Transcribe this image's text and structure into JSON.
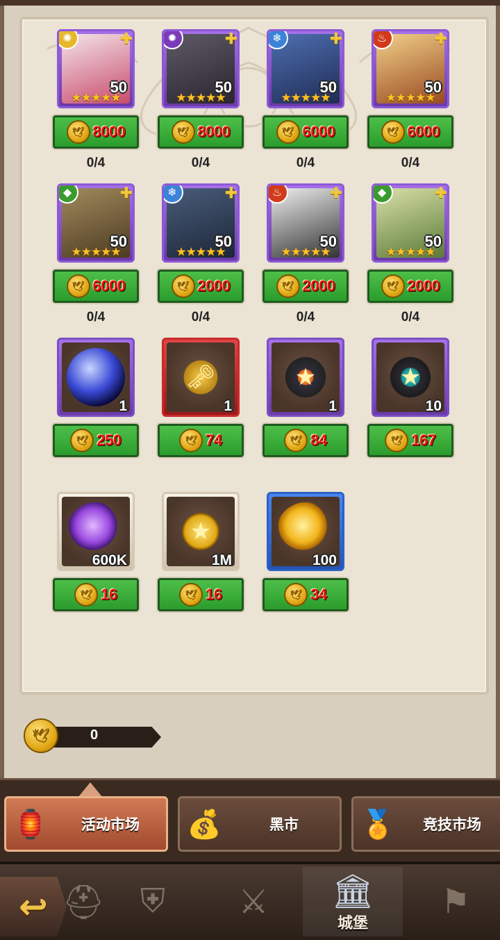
{
  "shop": {
    "heroes": [
      {
        "element": "light",
        "element_color": "#e8b72a",
        "element_glyph": "✺",
        "portrait_colors": [
          "#f3e5e8",
          "#c94b6d"
        ],
        "level": "50",
        "stars": "★★★★★",
        "price": "8000",
        "stock": "0/4"
      },
      {
        "element": "dark",
        "element_color": "#7b3bb8",
        "element_glyph": "✹",
        "portrait_colors": [
          "#5e5a66",
          "#2a2530"
        ],
        "level": "50",
        "stars": "★★★★★",
        "price": "8000",
        "stock": "0/4"
      },
      {
        "element": "water",
        "element_color": "#3b83d9",
        "element_glyph": "❄",
        "portrait_colors": [
          "#4e6fb0",
          "#1f2c55"
        ],
        "level": "50",
        "stars": "★★★★★",
        "price": "6000",
        "stock": "0/4"
      },
      {
        "element": "fire",
        "element_color": "#d13b1a",
        "element_glyph": "♨",
        "portrait_colors": [
          "#f0d08a",
          "#9a4a20"
        ],
        "level": "50",
        "stars": "★★★★★",
        "price": "6000",
        "stock": "0/4"
      },
      {
        "element": "nature",
        "element_color": "#3a9b2e",
        "element_glyph": "◆",
        "portrait_colors": [
          "#a08a5c",
          "#4c3a22"
        ],
        "level": "50",
        "stars": "★★★★★",
        "price": "6000",
        "stock": "0/4"
      },
      {
        "element": "water",
        "element_color": "#3b83d9",
        "element_glyph": "❄",
        "portrait_colors": [
          "#4a5d7a",
          "#1c2638"
        ],
        "level": "50",
        "stars": "★★★★★",
        "price": "2000",
        "stock": "0/4"
      },
      {
        "element": "fire",
        "element_color": "#d13b1a",
        "element_glyph": "♨",
        "portrait_colors": [
          "#eeeeee",
          "#333333"
        ],
        "level": "50",
        "stars": "★★★★★",
        "price": "2000",
        "stock": "0/4"
      },
      {
        "element": "nature",
        "element_color": "#3a9b2e",
        "element_glyph": "◆",
        "portrait_colors": [
          "#d9e0a8",
          "#5b7a3a"
        ],
        "level": "50",
        "stars": "★★★★★",
        "price": "2000",
        "stock": "0/4"
      }
    ],
    "items_row1": [
      {
        "icon": "crystal-orb-icon",
        "frame": "purple",
        "qty": "1",
        "price": "250"
      },
      {
        "icon": "golden-key-icon",
        "frame": "red",
        "qty": "1",
        "price": "74"
      },
      {
        "icon": "star-chip-icon",
        "frame": "purple",
        "qty": "1",
        "price": "84"
      },
      {
        "icon": "teal-chip-icon",
        "frame": "purple",
        "qty": "10",
        "price": "167"
      }
    ],
    "items_row2": [
      {
        "icon": "purple-orb-icon",
        "frame": "white",
        "qty": "600K",
        "price": "16"
      },
      {
        "icon": "gold-star-coin-icon",
        "frame": "white",
        "qty": "1M",
        "price": "16"
      },
      {
        "icon": "gold-orb-icon",
        "frame": "blue",
        "qty": "100",
        "price": "34"
      }
    ]
  },
  "wallet": {
    "amount": "0"
  },
  "tabs": [
    {
      "label": "活动市场",
      "icon": "lantern-icon",
      "active": true
    },
    {
      "label": "黑市",
      "icon": "money-bag-icon",
      "active": false
    },
    {
      "label": "竞技市场",
      "icon": "arena-medal-icon",
      "active": false
    }
  ],
  "bottom_nav": [
    {
      "label": "",
      "icon": "knight-helmet-icon"
    },
    {
      "label": "",
      "icon": "helmet-icon"
    },
    {
      "label": "",
      "icon": "crossed-swords-icon"
    },
    {
      "label": "城堡",
      "icon": "castle-icon",
      "active": true
    },
    {
      "label": "",
      "icon": "flag-icon"
    }
  ],
  "colors": {
    "panel_bg": "#ebe3d4",
    "price_red": "#e01616",
    "button_green": "#2b9c2c",
    "frame_purple": "#8d5ad6"
  }
}
